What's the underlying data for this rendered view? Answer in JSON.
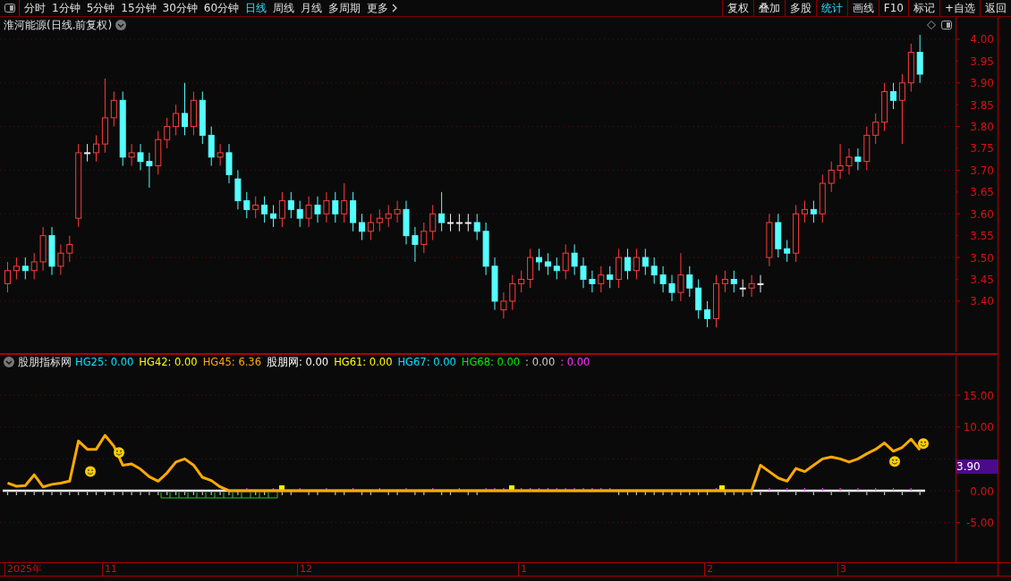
{
  "toolbar": {
    "periods": [
      {
        "label": "分时",
        "selected": false
      },
      {
        "label": "1分钟",
        "selected": false
      },
      {
        "label": "5分钟",
        "selected": false
      },
      {
        "label": "15分钟",
        "selected": false
      },
      {
        "label": "30分钟",
        "selected": false
      },
      {
        "label": "60分钟",
        "selected": false
      },
      {
        "label": "日线",
        "selected": true
      },
      {
        "label": "周线",
        "selected": false
      },
      {
        "label": "月线",
        "selected": false
      },
      {
        "label": "多周期",
        "selected": false
      }
    ],
    "more": "更多",
    "tools": [
      {
        "label": "复权",
        "selected": false
      },
      {
        "label": "叠加",
        "selected": false
      },
      {
        "label": "多股",
        "selected": false
      },
      {
        "label": "统计",
        "selected": true
      },
      {
        "label": "画线",
        "selected": false
      },
      {
        "label": "F10",
        "selected": false
      },
      {
        "label": "标记",
        "selected": false
      },
      {
        "label": "+自选",
        "selected": false
      },
      {
        "label": "返回",
        "selected": false
      }
    ]
  },
  "price_panel": {
    "title": "淮河能源(日线.前复权)",
    "chart_data": {
      "type": "candlestick",
      "grid": true,
      "ylim": [
        3.279,
        4.051
      ],
      "yticks": [
        {
          "value": 4.0,
          "label": "4.00"
        },
        {
          "value": 3.95,
          "label": "3.95"
        },
        {
          "value": 3.9,
          "label": "3.90"
        },
        {
          "value": 3.85,
          "label": "3.85"
        },
        {
          "value": 3.8,
          "label": "3.80"
        },
        {
          "value": 3.75,
          "label": "3.75"
        },
        {
          "value": 3.7,
          "label": "3.70"
        },
        {
          "value": 3.65,
          "label": "3.65"
        },
        {
          "value": 3.6,
          "label": "3.60"
        },
        {
          "value": 3.55,
          "label": "3.55"
        },
        {
          "value": 3.5,
          "label": "3.50"
        },
        {
          "value": 3.45,
          "label": "3.45"
        },
        {
          "value": 3.4,
          "label": "3.40"
        }
      ],
      "ohlc": [
        [
          3.44,
          3.49,
          3.42,
          3.47
        ],
        [
          3.47,
          3.5,
          3.45,
          3.48
        ],
        [
          3.48,
          3.5,
          3.45,
          3.47
        ],
        [
          3.47,
          3.51,
          3.45,
          3.49
        ],
        [
          3.49,
          3.57,
          3.47,
          3.55
        ],
        [
          3.55,
          3.57,
          3.46,
          3.48
        ],
        [
          3.48,
          3.53,
          3.46,
          3.51
        ],
        [
          3.51,
          3.55,
          3.49,
          3.53
        ],
        [
          3.59,
          3.76,
          3.57,
          3.74
        ],
        [
          3.74,
          3.76,
          3.72,
          3.74
        ],
        [
          3.74,
          3.78,
          3.72,
          3.76
        ],
        [
          3.76,
          3.91,
          3.74,
          3.82
        ],
        [
          3.82,
          3.88,
          3.8,
          3.86
        ],
        [
          3.86,
          3.88,
          3.71,
          3.73
        ],
        [
          3.73,
          3.76,
          3.71,
          3.74
        ],
        [
          3.74,
          3.76,
          3.7,
          3.72
        ],
        [
          3.72,
          3.74,
          3.66,
          3.71
        ],
        [
          3.71,
          3.79,
          3.69,
          3.77
        ],
        [
          3.77,
          3.82,
          3.75,
          3.8
        ],
        [
          3.8,
          3.85,
          3.78,
          3.83
        ],
        [
          3.83,
          3.9,
          3.78,
          3.8
        ],
        [
          3.8,
          3.88,
          3.78,
          3.86
        ],
        [
          3.86,
          3.88,
          3.76,
          3.78
        ],
        [
          3.78,
          3.8,
          3.71,
          3.73
        ],
        [
          3.73,
          3.76,
          3.71,
          3.74
        ],
        [
          3.74,
          3.76,
          3.67,
          3.69
        ],
        [
          3.68,
          3.7,
          3.61,
          3.63
        ],
        [
          3.63,
          3.65,
          3.59,
          3.61
        ],
        [
          3.61,
          3.64,
          3.59,
          3.62
        ],
        [
          3.62,
          3.64,
          3.58,
          3.6
        ],
        [
          3.6,
          3.62,
          3.57,
          3.59
        ],
        [
          3.59,
          3.65,
          3.57,
          3.63
        ],
        [
          3.63,
          3.65,
          3.59,
          3.61
        ],
        [
          3.61,
          3.63,
          3.57,
          3.59
        ],
        [
          3.59,
          3.64,
          3.57,
          3.62
        ],
        [
          3.62,
          3.64,
          3.58,
          3.6
        ],
        [
          3.6,
          3.65,
          3.58,
          3.63
        ],
        [
          3.63,
          3.65,
          3.58,
          3.6
        ],
        [
          3.6,
          3.67,
          3.58,
          3.63
        ],
        [
          3.63,
          3.65,
          3.56,
          3.58
        ],
        [
          3.58,
          3.6,
          3.54,
          3.56
        ],
        [
          3.56,
          3.6,
          3.54,
          3.58
        ],
        [
          3.58,
          3.61,
          3.56,
          3.59
        ],
        [
          3.59,
          3.62,
          3.57,
          3.6
        ],
        [
          3.6,
          3.63,
          3.58,
          3.61
        ],
        [
          3.61,
          3.63,
          3.53,
          3.55
        ],
        [
          3.55,
          3.57,
          3.49,
          3.53
        ],
        [
          3.53,
          3.58,
          3.51,
          3.56
        ],
        [
          3.56,
          3.62,
          3.54,
          3.6
        ],
        [
          3.6,
          3.65,
          3.56,
          3.58
        ],
        [
          3.58,
          3.6,
          3.56,
          3.58
        ],
        [
          3.58,
          3.6,
          3.56,
          3.58
        ],
        [
          3.58,
          3.6,
          3.56,
          3.58
        ],
        [
          3.58,
          3.6,
          3.54,
          3.56
        ],
        [
          3.56,
          3.58,
          3.46,
          3.48
        ],
        [
          3.48,
          3.5,
          3.38,
          3.4
        ],
        [
          3.38,
          3.42,
          3.36,
          3.4
        ],
        [
          3.4,
          3.46,
          3.38,
          3.44
        ],
        [
          3.44,
          3.47,
          3.42,
          3.45
        ],
        [
          3.45,
          3.52,
          3.43,
          3.5
        ],
        [
          3.5,
          3.52,
          3.47,
          3.49
        ],
        [
          3.49,
          3.51,
          3.46,
          3.48
        ],
        [
          3.48,
          3.5,
          3.45,
          3.47
        ],
        [
          3.47,
          3.53,
          3.45,
          3.51
        ],
        [
          3.51,
          3.53,
          3.46,
          3.48
        ],
        [
          3.48,
          3.5,
          3.43,
          3.45
        ],
        [
          3.45,
          3.47,
          3.42,
          3.44
        ],
        [
          3.44,
          3.48,
          3.42,
          3.46
        ],
        [
          3.46,
          3.48,
          3.43,
          3.45
        ],
        [
          3.45,
          3.52,
          3.43,
          3.5
        ],
        [
          3.5,
          3.52,
          3.45,
          3.47
        ],
        [
          3.47,
          3.52,
          3.45,
          3.5
        ],
        [
          3.5,
          3.52,
          3.46,
          3.48
        ],
        [
          3.48,
          3.5,
          3.44,
          3.46
        ],
        [
          3.46,
          3.48,
          3.42,
          3.44
        ],
        [
          3.44,
          3.46,
          3.4,
          3.42
        ],
        [
          3.42,
          3.51,
          3.4,
          3.46
        ],
        [
          3.46,
          3.48,
          3.41,
          3.43
        ],
        [
          3.43,
          3.45,
          3.36,
          3.38
        ],
        [
          3.38,
          3.4,
          3.34,
          3.36
        ],
        [
          3.36,
          3.46,
          3.34,
          3.44
        ],
        [
          3.44,
          3.47,
          3.42,
          3.45
        ],
        [
          3.45,
          3.47,
          3.42,
          3.44
        ],
        [
          3.43,
          3.45,
          3.41,
          3.43
        ],
        [
          3.43,
          3.46,
          3.41,
          3.44
        ],
        [
          3.44,
          3.46,
          3.42,
          3.44
        ],
        [
          3.5,
          3.6,
          3.48,
          3.58
        ],
        [
          3.58,
          3.6,
          3.5,
          3.52
        ],
        [
          3.52,
          3.54,
          3.49,
          3.51
        ],
        [
          3.51,
          3.62,
          3.49,
          3.6
        ],
        [
          3.6,
          3.63,
          3.58,
          3.61
        ],
        [
          3.61,
          3.63,
          3.58,
          3.6
        ],
        [
          3.6,
          3.69,
          3.58,
          3.67
        ],
        [
          3.67,
          3.72,
          3.65,
          3.7
        ],
        [
          3.7,
          3.76,
          3.68,
          3.71
        ],
        [
          3.71,
          3.75,
          3.69,
          3.73
        ],
        [
          3.73,
          3.75,
          3.7,
          3.72
        ],
        [
          3.72,
          3.8,
          3.7,
          3.78
        ],
        [
          3.78,
          3.83,
          3.76,
          3.81
        ],
        [
          3.81,
          3.9,
          3.79,
          3.88
        ],
        [
          3.88,
          3.9,
          3.84,
          3.86
        ],
        [
          3.86,
          3.92,
          3.76,
          3.9
        ],
        [
          3.9,
          3.99,
          3.88,
          3.97
        ],
        [
          3.97,
          4.01,
          3.9,
          3.92
        ]
      ]
    }
  },
  "indicator_panel": {
    "name": "股朋指标网",
    "legend": [
      {
        "text": "HG25: 0.00",
        "color": "#00e5ff"
      },
      {
        "text": "HG42: 0.00",
        "color": "#ffff00"
      },
      {
        "text": "HG45: 6.36",
        "color": "#ffaa00"
      },
      {
        "text": "股朋网: 0.00",
        "color": "#ffffff"
      },
      {
        "text": "HG61: 0.00",
        "color": "#ffff00"
      },
      {
        "text": "HG67: 0.00",
        "color": "#00e5ff"
      },
      {
        "text": "HG68: 0.00",
        "color": "#00ee00"
      },
      {
        "text": ": 0.00",
        "color": "#cccccc"
      },
      {
        "text": ": 0.00",
        "color": "#ff33ff"
      }
    ],
    "current_value": "3.90",
    "chart_data": {
      "type": "line",
      "grid": true,
      "ylim": [
        -11.22,
        21.46
      ],
      "yticks": [
        {
          "value": 15,
          "label": "15.00"
        },
        {
          "value": 10,
          "label": "10.00"
        },
        {
          "value": 0,
          "label": "0.00"
        },
        {
          "value": -5,
          "label": "-5.00"
        }
      ],
      "series": [
        {
          "color": "#ffaa00",
          "values": [
            1.2,
            0.7,
            0.8,
            2.5,
            0.6,
            1,
            1.2,
            1.5,
            7.8,
            6.5,
            6.5,
            8.7,
            7,
            4,
            4.2,
            3.4,
            2.2,
            1.5,
            2.8,
            4.5,
            5,
            4,
            2.1,
            1.6,
            0.6,
            0,
            0,
            0,
            0,
            0,
            0,
            0,
            0,
            0,
            0,
            0,
            0,
            0,
            0,
            0,
            0,
            0,
            0,
            0,
            0,
            0,
            0,
            0,
            0,
            0,
            0,
            0,
            0,
            0,
            0,
            0,
            0,
            0,
            0,
            0,
            0,
            0,
            0,
            0,
            0,
            0,
            0,
            0,
            0,
            0,
            0,
            0,
            0,
            0,
            0,
            0,
            0,
            0,
            0,
            0,
            0,
            0,
            0,
            0,
            0,
            4,
            3,
            2,
            1.5,
            3.5,
            3,
            4,
            5,
            5.3,
            5,
            4.5,
            5,
            5.8,
            6.5,
            7.5,
            6.2,
            6.8,
            8.1,
            6.4
          ]
        }
      ]
    }
  },
  "date_axis": [
    "2025年",
    "11",
    "12",
    "1",
    "2",
    "3"
  ]
}
